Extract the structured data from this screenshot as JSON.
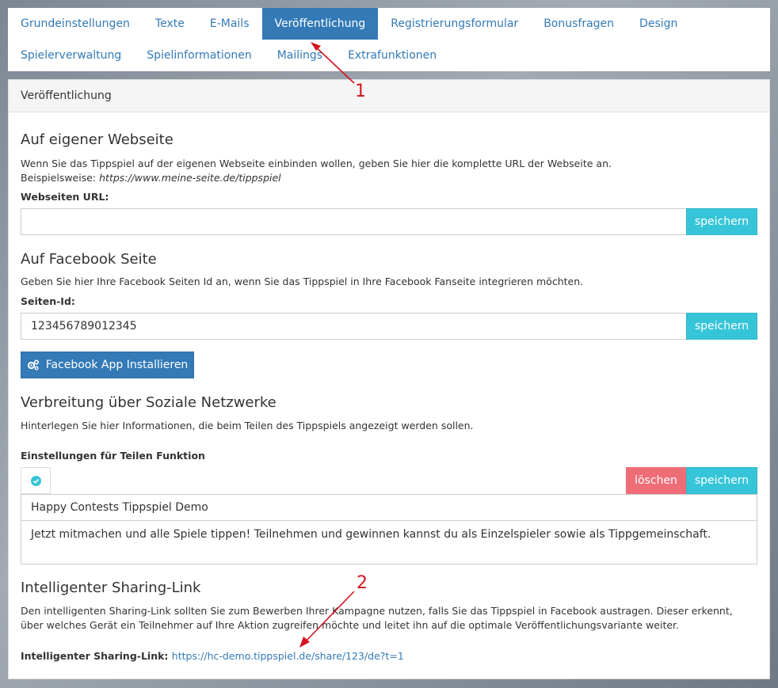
{
  "tabs_row1": [
    "Grundeinstellungen",
    "Texte",
    "E-Mails",
    "Veröffentlichung",
    "Registrierungsformular",
    "Bonusfragen",
    "Design"
  ],
  "tabs_row2": [
    "Spielerverwaltung",
    "Spielinformationen",
    "Mailings",
    "Extrafunktionen"
  ],
  "active_tab": "Veröffentlichung",
  "panel_title": "Veröffentlichung",
  "website": {
    "heading": "Auf eigener Webseite",
    "desc": "Wenn Sie das Tippspiel auf der eigenen Webseite einbinden wollen, geben Sie hier die komplette URL der Webseite an.",
    "example_prefix": "Beispielsweise:",
    "example_url": "https://www.meine-seite.de/tippspiel",
    "label": "Webseiten URL:",
    "value": "",
    "save": "speichern"
  },
  "facebook": {
    "heading": "Auf Facebook Seite",
    "desc": "Geben Sie hier Ihre Facebook Seiten Id an, wenn Sie das Tippspiel in Ihre Facebook Fanseite integrieren möchten.",
    "label": "Seiten-Id:",
    "value": "123456789012345",
    "save": "speichern",
    "install_button": "Facebook App Installieren"
  },
  "social": {
    "heading": "Verbreitung über Soziale Netzwerke",
    "desc": "Hinterlegen Sie hier Informationen, die beim Teilen des Tippspiels angezeigt werden sollen.",
    "label": "Einstellungen für Teilen Funktion",
    "delete": "löschen",
    "save": "speichern",
    "share_title": "Happy Contests Tippspiel Demo",
    "share_text": "Jetzt mitmachen und alle Spiele tippen! Teilnehmen und gewinnen kannst du als Einzelspieler sowie als Tippgemeinschaft."
  },
  "sharing": {
    "heading": "Intelligenter Sharing-Link",
    "desc": "Den intelligenten Sharing-Link sollten Sie zum Bewerben Ihrer Kampagne nutzen, falls Sie das Tippspiel in Facebook austragen. Dieser erkennt, über welches Gerät ein Teilnehmer auf Ihre Aktion zugreifen möchte und leitet ihn auf die optimale Veröffentlichungsvariante weiter.",
    "label": "Intelligenter Sharing-Link:",
    "link": "https://hc-demo.tippspiel.de/share/123/de?t=1"
  },
  "annotations": [
    "1",
    "2"
  ],
  "colors": {
    "accent": "#337ab7",
    "save": "#36c5d8",
    "delete": "#ef6d76",
    "annotation": "#d4141f"
  }
}
